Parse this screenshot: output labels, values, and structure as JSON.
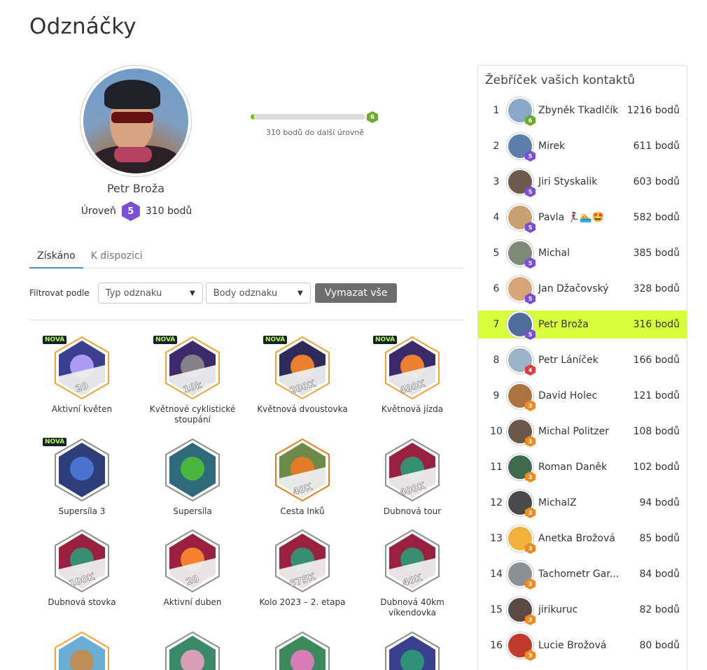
{
  "page": {
    "title": "Odznáčky"
  },
  "profile": {
    "name": "Petr Broža",
    "level_label": "Úroveň",
    "level": "5",
    "points": "310 bodů",
    "next_level": "6",
    "progress_fraction": 0.03,
    "progress_text": "310 bodů do další úrovně"
  },
  "tabs": [
    {
      "label": "Získáno",
      "active": true
    },
    {
      "label": "K dispozici",
      "active": false
    }
  ],
  "filter": {
    "label": "Filtrovat podle",
    "type_select": "Typ odznaku",
    "points_select": "Body odznaku",
    "clear_button": "Vymazat vše"
  },
  "badges": [
    {
      "label": "Aktivní květen",
      "new": "NOVÁ",
      "text": "20",
      "year": "2023"
    },
    {
      "label": "Květnové cyklistické stoupání",
      "new": "NOVÁ",
      "text": "10k",
      "year": "2023"
    },
    {
      "label": "Květnová dvoustovka",
      "new": "NOVÁ",
      "text": "200K",
      "year": "2023"
    },
    {
      "label": "Květnová jízda",
      "new": "NOVÁ",
      "text": "400K",
      "year": "2023"
    },
    {
      "label": "Supersíla 3",
      "new": "NOVÁ",
      "text": "",
      "year": ""
    },
    {
      "label": "Supersíla",
      "new": "",
      "text": "",
      "year": ""
    },
    {
      "label": "Cesta Inků",
      "new": "",
      "text": "40K",
      "year": ""
    },
    {
      "label": "Dubnová tour",
      "new": "",
      "text": "400K",
      "year": "2023"
    },
    {
      "label": "Dubnová stovka",
      "new": "",
      "text": "100K",
      "year": "2023"
    },
    {
      "label": "Aktivní duben",
      "new": "",
      "text": "20",
      "year": "2023"
    },
    {
      "label": "Kolo 2023 – 2. etapa",
      "new": "",
      "text": "675K",
      "year": "2023"
    },
    {
      "label": "Dubnová 40km víkendovka",
      "new": "",
      "text": "40K",
      "year": "2023"
    },
    {
      "label": "",
      "new": "",
      "text": "",
      "year": ""
    },
    {
      "label": "",
      "new": "",
      "text": "",
      "year": ""
    },
    {
      "label": "",
      "new": "",
      "text": "",
      "year": ""
    },
    {
      "label": "",
      "new": "",
      "text": "",
      "year": ""
    }
  ],
  "leaderboard": {
    "title": "Žebříček vašich kontaktů",
    "rows": [
      {
        "rank": "1",
        "name": "Zbyněk Tkadlčík",
        "points": "1216 bodů",
        "level": "6",
        "level_color": "#6aac2a",
        "avatar_color": "#8aa9c9"
      },
      {
        "rank": "2",
        "name": "Mirek",
        "points": "611 bodů",
        "level": "5",
        "level_color": "#7a4ed6",
        "avatar_color": "#5b7fa6"
      },
      {
        "rank": "3",
        "name": "Jiri Styskalik",
        "points": "603 bodů",
        "level": "5",
        "level_color": "#7a4ed6",
        "avatar_color": "#6d5a4a"
      },
      {
        "rank": "4",
        "name": "Pavla 🏃‍♀️🏊🤩",
        "points": "582 bodů",
        "level": "5",
        "level_color": "#7a4ed6",
        "avatar_color": "#c9a070"
      },
      {
        "rank": "5",
        "name": "Michal",
        "points": "385 bodů",
        "level": "5",
        "level_color": "#7a4ed6",
        "avatar_color": "#7d8a76"
      },
      {
        "rank": "6",
        "name": "Jan Džačovský",
        "points": "328 bodů",
        "level": "5",
        "level_color": "#7a4ed6",
        "avatar_color": "#d6a676"
      },
      {
        "rank": "7",
        "name": "Petr Broža",
        "points": "316 bodů",
        "level": "5",
        "level_color": "#7a4ed6",
        "avatar_color": "#4d6e98",
        "highlight": true
      },
      {
        "rank": "8",
        "name": "Petr Láníček",
        "points": "166 bodů",
        "level": "4",
        "level_color": "#e23d3d",
        "avatar_color": "#9bb4c9"
      },
      {
        "rank": "9",
        "name": "David Holec",
        "points": "121 bodů",
        "level": "3",
        "level_color": "#ef8a22",
        "avatar_color": "#a9743f"
      },
      {
        "rank": "10",
        "name": "Michal Politzer",
        "points": "108 bodů",
        "level": "3",
        "level_color": "#ef8a22",
        "avatar_color": "#6b5848"
      },
      {
        "rank": "11",
        "name": "Roman Daněk",
        "points": "102 bodů",
        "level": "3",
        "level_color": "#ef8a22",
        "avatar_color": "#3e6a4e"
      },
      {
        "rank": "12",
        "name": "MichalZ",
        "points": "94 bodů",
        "level": "3",
        "level_color": "#ef8a22",
        "avatar_color": "#4a4a4a"
      },
      {
        "rank": "13",
        "name": "Anetka Brožová",
        "points": "85 bodů",
        "level": "3",
        "level_color": "#ef8a22",
        "avatar_color": "#f2b13b"
      },
      {
        "rank": "14",
        "name": "Tachometr Gar...",
        "points": "84 bodů",
        "level": "3",
        "level_color": "#ef8a22",
        "avatar_color": "#8b8f96"
      },
      {
        "rank": "15",
        "name": "jirikuruc",
        "points": "82 bodů",
        "level": "3",
        "level_color": "#ef8a22",
        "avatar_color": "#5a4a42"
      },
      {
        "rank": "16",
        "name": "Lucie Brožová",
        "points": "80 bodů",
        "level": "3",
        "level_color": "#ef8a22",
        "avatar_color": "#c23a2c"
      }
    ]
  }
}
